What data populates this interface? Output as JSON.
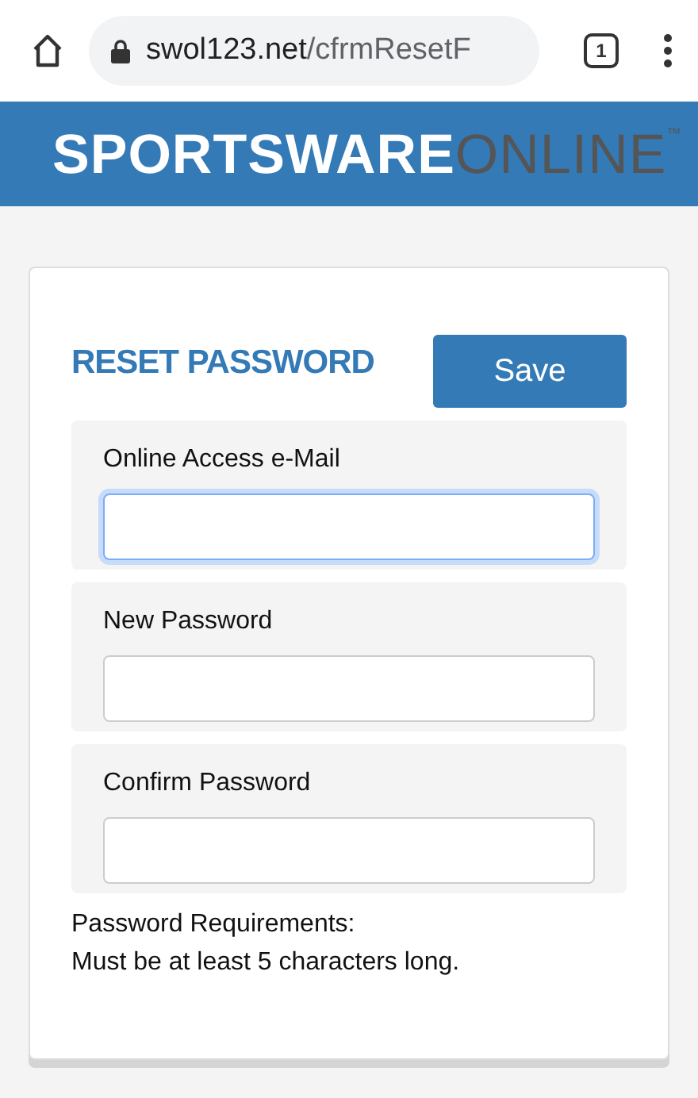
{
  "browser": {
    "url_host": "swol123.net",
    "url_path": "/cfrmResetF",
    "tab_count": "1"
  },
  "logo": {
    "strong": "SPORTSWARE",
    "light": "ONLINE",
    "mark": "™"
  },
  "form": {
    "title": "RESET PASSWORD",
    "save_button": "Save",
    "fields": [
      {
        "label": "Online Access e-Mail",
        "focused": true
      },
      {
        "label": "New Password",
        "focused": false
      },
      {
        "label": "Confirm Password",
        "focused": false
      }
    ],
    "requirements": [
      "Password Requirements:",
      "Must be at least 5 characters long."
    ]
  }
}
